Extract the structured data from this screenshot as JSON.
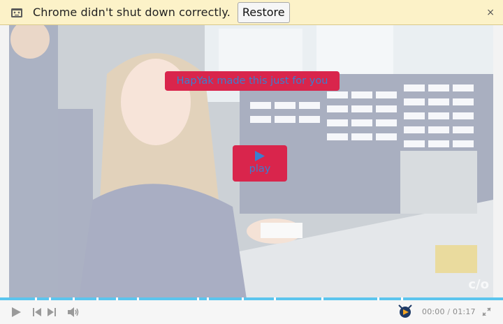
{
  "infobar": {
    "message": "Chrome didn't shut down correctly.",
    "restore_label": "Restore",
    "close_glyph": "×",
    "icon": "crashed-tab-icon"
  },
  "video": {
    "banner_text": "HapYak made this just for you",
    "play_label": "play",
    "play_glyph": "▶",
    "watermark": "c/o",
    "accent_color": "#d9254c",
    "link_text_color": "#3a7fd0"
  },
  "player": {
    "progress_fraction": 0.0,
    "progress_color": "#5bc5ee",
    "current_time": "00:00",
    "separator": "/",
    "duration": "01:17",
    "icons": [
      "play-icon",
      "previous-icon",
      "next-icon",
      "volume-icon",
      "hapyak-logo-icon",
      "fullscreen-icon"
    ]
  }
}
